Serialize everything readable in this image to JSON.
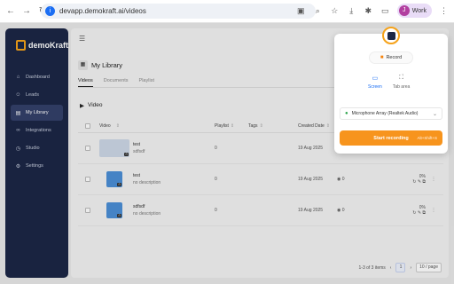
{
  "browser": {
    "url": "devapp.demokraft.ai/videos",
    "profile_initial": "J",
    "profile_label": "Work"
  },
  "sidebar": {
    "brand": "demoKraft",
    "items": [
      {
        "label": "Dashboard",
        "icon": "home-icon"
      },
      {
        "label": "Leads",
        "icon": "user-icon"
      },
      {
        "label": "My Library",
        "icon": "library-icon",
        "active": true
      },
      {
        "label": "Integrations",
        "icon": "link-icon"
      },
      {
        "label": "Studio",
        "icon": "clock-icon"
      },
      {
        "label": "Settings",
        "icon": "gear-icon"
      }
    ]
  },
  "main": {
    "title": "My Library",
    "tabs": [
      "Videos",
      "Documents",
      "Playlist"
    ],
    "section": "Video",
    "columns": [
      "Video",
      "Playlist",
      "Tags",
      "Created Date"
    ],
    "rows": [
      {
        "title": "test",
        "desc": "sdfsdf",
        "playlist": "0",
        "date": "19 Aug 2025",
        "stat": "0"
      },
      {
        "title": "test",
        "desc": "no description",
        "playlist": "0",
        "date": "19 Aug 2025",
        "stat": "0"
      },
      {
        "title": "sdfsdf",
        "desc": "no description",
        "playlist": "0",
        "date": "19 Aug 2025",
        "stat": "0"
      }
    ],
    "row_pct": "0%",
    "pager": {
      "range": "1-3 of 3 items",
      "page": "1",
      "per_page": "10 / page"
    }
  },
  "popup": {
    "record": "Record",
    "modes": [
      "Screen",
      "Tab area"
    ],
    "mic": "Microphone Array (Realtek Audio)",
    "start": "Start recording",
    "shortcut": "Alt+Shift+S"
  }
}
